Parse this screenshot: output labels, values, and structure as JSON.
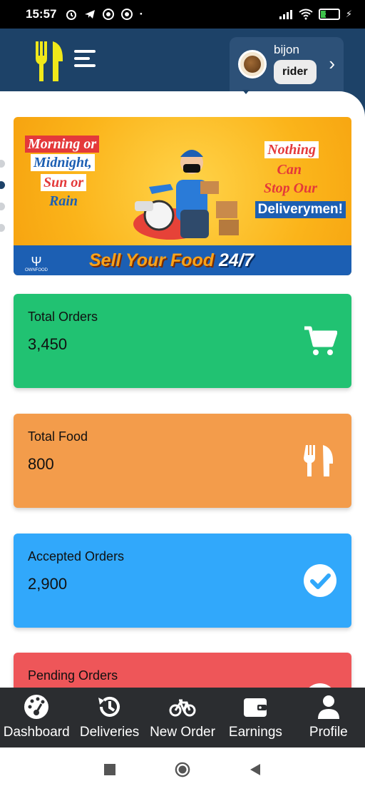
{
  "status_bar": {
    "time": "15:57",
    "battery": "29"
  },
  "header": {
    "user_name": "bijon",
    "user_role": "rider"
  },
  "banner": {
    "left_lines": [
      "Morning or",
      "Midnight,",
      "Sun or",
      "Rain"
    ],
    "right_lines": [
      "Nothing",
      "Can",
      "Stop Our",
      "Deliverymen!"
    ],
    "cta_text": "Sell Your Food",
    "cta_highlight": "24/7",
    "brand": "OWNFOOD",
    "slide_count": 4,
    "active_slide": 2
  },
  "stats": [
    {
      "label": "Total Orders",
      "value": "3,450",
      "icon": "cart-icon",
      "color": "#21c272"
    },
    {
      "label": "Total Food",
      "value": "800",
      "icon": "utensils-icon",
      "color": "#f39c4b"
    },
    {
      "label": "Accepted Orders",
      "value": "2,900",
      "icon": "check-circle-icon",
      "color": "#31a8fb"
    },
    {
      "label": "Pending Orders",
      "value": "",
      "icon": "clock-icon",
      "color": "#ee5659"
    }
  ],
  "bottom_nav": [
    {
      "label": "Dashboard",
      "icon": "dashboard-gauge-icon"
    },
    {
      "label": "Deliveries",
      "icon": "history-icon"
    },
    {
      "label": "New Order",
      "icon": "bicycle-icon"
    },
    {
      "label": "Earnings",
      "icon": "wallet-icon"
    },
    {
      "label": "Profile",
      "icon": "user-icon"
    }
  ],
  "colors": {
    "header_bg": "#1d4268",
    "nav_bg": "#2b2d30",
    "logo_yellow": "#f0e81a"
  }
}
